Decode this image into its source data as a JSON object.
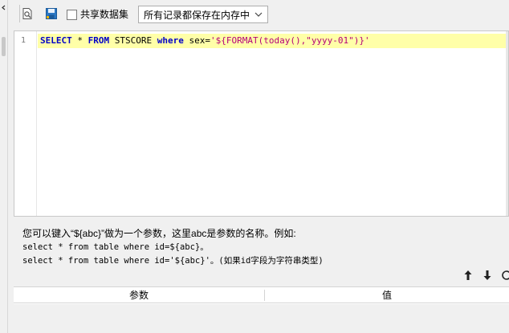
{
  "toolbar": {
    "buttons": [
      {
        "name": "preview-icon"
      },
      {
        "name": "save-icon"
      }
    ],
    "share_dataset_label": "共享数据集",
    "share_dataset_checked": false,
    "record_mode": {
      "selected": "所有记录都保存在内存中"
    }
  },
  "editor": {
    "line_numbers": [
      "1"
    ],
    "tokens": [
      {
        "text": "SELECT",
        "kind": "kw"
      },
      {
        "text": " * ",
        "kind": "id"
      },
      {
        "text": "FROM",
        "kind": "kw"
      },
      {
        "text": " STSCORE ",
        "kind": "id"
      },
      {
        "text": "where",
        "kind": "kw"
      },
      {
        "text": " sex=",
        "kind": "id"
      },
      {
        "text": "'${FORMAT(today(),\"yyyy-01\")}'",
        "kind": "str"
      }
    ]
  },
  "help": {
    "line1": "您可以键入“${abc}”做为一个参数，这里abc是参数的名称。例如:",
    "line2": "select * from table where id=${abc}。",
    "line3": "select * from table where id='${abc}'。(如果id字段为字符串类型)"
  },
  "param_nav": {
    "up": "up-arrow-icon",
    "down": "down-arrow-icon",
    "refresh": "refresh-icon"
  },
  "params_table": {
    "columns": [
      "参数",
      "值"
    ],
    "rows": []
  },
  "colors": {
    "keyword": "#0000c8",
    "string": "#b4007a",
    "current_line": "#ffffa8"
  }
}
